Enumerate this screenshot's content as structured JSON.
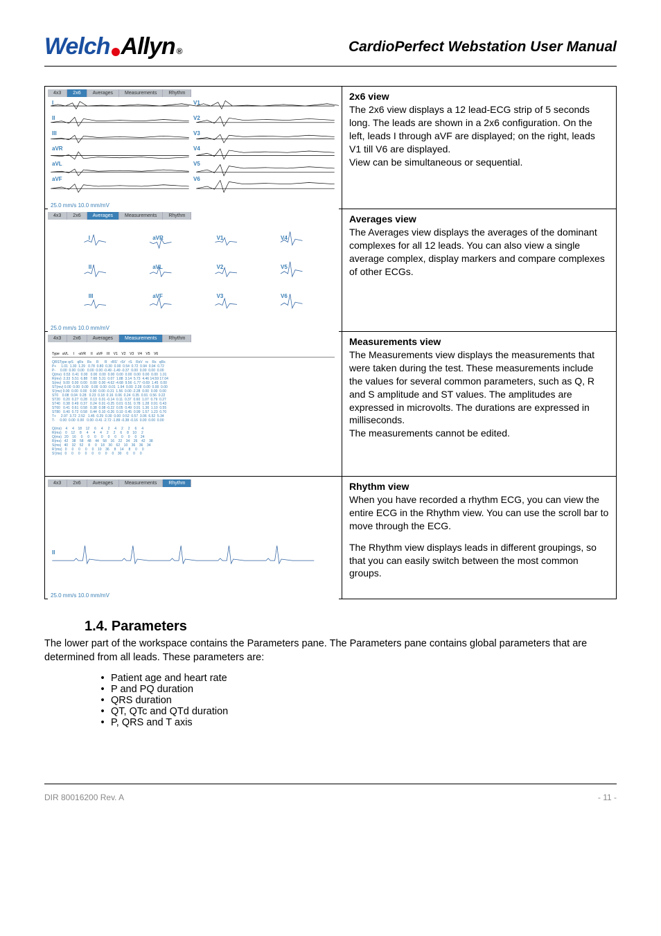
{
  "header": {
    "logo_part1": "Welch",
    "logo_part2": "Allyn",
    "manual_title": "CardioPerfect Webstation User Manual"
  },
  "tabs": {
    "t1": "4x3",
    "t2": "2x6",
    "t3": "Averages",
    "t4": "Measurements",
    "t5": "Rhythm"
  },
  "scale_label": "25.0 mm/s 10.0 mm/mV",
  "leads": {
    "I": "I",
    "II": "II",
    "III": "III",
    "aVR": "aVR",
    "aVL": "aVL",
    "aVF": "aVF",
    "V1": "V1",
    "V2": "V2",
    "V3": "V3",
    "V4": "V4",
    "V5": "V5",
    "V6": "V6"
  },
  "views": [
    {
      "title": "2x6 view",
      "body": "The 2x6 view displays a 12 lead-ECG strip of 5 seconds long. The leads are shown in a 2x6 configuration. On the left, leads I through aVF are displayed; on the right, leads V1 till V6 are displayed.\nView can be simultaneous or sequential."
    },
    {
      "title": "Averages view",
      "body": "The Averages view displays the averages of the dominant complexes for all 12 leads. You can also view a single average complex, display markers and compare complexes of other ECGs."
    },
    {
      "title": "Measurements view",
      "body": "The Measurements view displays the measurements that were taken during the test. These measurements include the values for several common parameters, such as Q, R and S amplitude and ST values. The amplitudes are expressed in microvolts. The durations are expressed in milliseconds.\nThe measurements cannot be edited."
    },
    {
      "title": "Rhythm view",
      "body_p1": "When you have recorded a rhythm ECG, you can view the entire ECG in the Rhythm view. You can use the scroll bar to move through the ECG.",
      "body_p2": "The Rhythm view displays leads in different groupings, so that you can easily switch between the most common groups."
    }
  ],
  "measurements_header": "Type   aVL     I    -aVR     II    aVF    III    V1    V2    V3    V4    V5    V6",
  "measurements_rows": "QRSType qrS    qRs    Rs     R      R    rRS'   rSr'   rS    RsV   rs    Rs   qRs\nP+     1.01  1.30  1.29   0.78  0.80  0.30  0.00  0.54  0.72  0.94  0.94  0.72\nP-     0.00  0.00  0.00   0.00  0.00 -0.49 -1.49 -0.37  0.00  0.00  0.00  0.00\nQ(mv)  0.53  0.41  0.00   0.00  0.00  0.00  0.00  0.00  0.00  0.00  0.00  1.01\nR(mv)  2.33  5.51  6.88   7.68  5.31  0.07  1.88  3.14  5.73  4.46 14.59 17.04\nS(mv)  9.00  0.00  0.00   0.00  0.00 -4.62 -4.68  9.56 -1.77 -0.69  1.45  0.00\nST(mv) 0.00  0.00  0.00   0.00  0.00 -0.01  1.94  0.00  2.28  0.00  0.00  0.00\nS'(mv) 0.00  0.00  0.00   0.00  0.00 -0.31  1.56  0.00 -2.28  0.00  0.00  0.00\nST0    0.08  0.04  0.28   0.23  0.18  0.16  0.06  0.24  0.35  0.91  0.56  0.22\nST20   0.20  0.27  0.28   0.13  0.01 -0.14  0.11  0.37  0.60  1.07  0.79  0.27\nST40   0.38  0.49  0.37   0.24  0.01 -0.25  0.01  0.51  0.78  1.28  0.91  0.43\nST60   0.41  0.61  0.58   0.38  0.08 -0.22  0.05  0.49  0.91  1.36  1.10  0.55\nST80   0.40  0.72  0.58   0.44  0.10 -0.26  0.10  0.45  0.99  1.57  1.23  0.70\nT+     2.97  3.72  2.52   1.45  0.29  0.30  0.00  0.52  0.57  3.06  6.52  5.34\nT-     0.00  0.00  0.00   0.00 -0.41 -2.72 -1.89 -0.38 -0.16  0.00  0.00  0.00\n\nQ(ms)    4     4    18    12     6     4     2     4     2     2     6     4\nR(ms)    0    12     8     4     4     4     2     2     6     8    10     2\nQ(ms)   20    16     0     0     0     0     0     0     0     0     0    24\nR(ms)   42    38    58    48    44    58    16    22    34    26    42    38\nS(ms)   40    32    52     8     0    18    30    62    10    36    36    34\nR'(ms)   0     0     0     0     0    10    36     8    14     8     0     0\nS'(ms)   0     0     0     0     0     0     0     0    30     0     0     0",
  "section": {
    "number_title": "1.4.  Parameters",
    "intro": "The lower part of the workspace contains the Parameters pane. The Parameters pane contains global parameters that are determined from all leads. These parameters are:",
    "items": [
      "Patient age and heart rate",
      "P and PQ duration",
      "QRS duration",
      "QT, QTc and QTd duration",
      "P, QRS and T axis"
    ]
  },
  "footer": {
    "left": "DIR 80016200 Rev. A",
    "right": "- 11 -"
  }
}
